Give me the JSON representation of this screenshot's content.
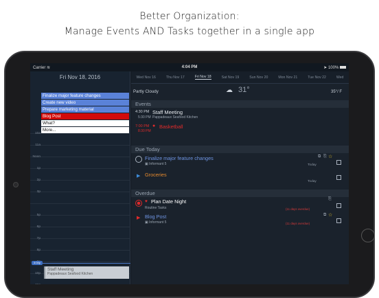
{
  "caption": {
    "line1": "Better Organization:",
    "line2": "Manage Events AND Tasks together in a single app"
  },
  "status": {
    "carrier": "Carrier",
    "time": "4:04 PM",
    "battery": "100%"
  },
  "left": {
    "date": "Fri Nov 18, 2016",
    "tasks": [
      {
        "label": "Finalize major feature changes",
        "bg": "#5a82d8",
        "fg": "#ffffff"
      },
      {
        "label": "Create new video",
        "bg": "#5a82d8",
        "fg": "#ffffff"
      },
      {
        "label": "Prepare marketing material",
        "bg": "#5a82d8",
        "fg": "#ffffff"
      },
      {
        "label": "Blog Post",
        "bg": "#d20a0a",
        "fg": "#ffffff"
      },
      {
        "label": "What?",
        "bg": "#ffffff",
        "fg": "#111111"
      },
      {
        "label": "More...",
        "bg": "#ffffff",
        "fg": "#111111"
      }
    ],
    "hours": [
      "10a",
      "11a",
      "Noon",
      "1p",
      "2p",
      "3p",
      "",
      "5p",
      "6p",
      "7p",
      "8p",
      "9p",
      "10p",
      "11p"
    ],
    "now_label": "4:04p",
    "events": [
      {
        "title": "Staff Meeting",
        "location": "Pappadeaux Seafood Kitchen"
      },
      {
        "title": "Basketball"
      }
    ]
  },
  "week": [
    {
      "label": "Wed Nov 16",
      "selected": false
    },
    {
      "label": "Thu Nov 17",
      "selected": false
    },
    {
      "label": "Fri Nov 18",
      "selected": true
    },
    {
      "label": "Sat Nov 19",
      "selected": false
    },
    {
      "label": "Sun Nov 20",
      "selected": false
    },
    {
      "label": "Mon Nov 21",
      "selected": false
    },
    {
      "label": "Tue Nov 22",
      "selected": false
    },
    {
      "label": "Wed",
      "selected": false
    }
  ],
  "weather": {
    "condition": "Partly Cloudy",
    "temp": "31°",
    "hilo": "35°/",
    "unit": "F"
  },
  "sections": {
    "events": "Events",
    "due": "Due Today",
    "overdue": "Overdue"
  },
  "events": [
    {
      "start": "4:30 PM",
      "end": "5:30 PM",
      "title": "Staff Meeting",
      "location": "Pappadeaux Seafood Kitchen",
      "color": "#e6e6e6"
    },
    {
      "start": "7:00 PM",
      "end": "8:30 PM",
      "title": "Basketball",
      "location": "",
      "color": "#e02b2b"
    }
  ],
  "due": [
    {
      "title": "Finalize major feature changes",
      "sub": "Informant 5",
      "when": "Today",
      "color": "#6f95e3"
    },
    {
      "title": "Groceries",
      "sub": "",
      "when": "Today",
      "color": "#e58a2e"
    }
  ],
  "overdue": [
    {
      "title": "Plan Date Night",
      "sub": "Routine Tasks",
      "late": "(11 days overdue)",
      "color": "#ffffff"
    },
    {
      "title": "Blog Post",
      "sub": "Informant 5",
      "late": "(11 days overdue)",
      "color": "#6f95e3"
    }
  ]
}
